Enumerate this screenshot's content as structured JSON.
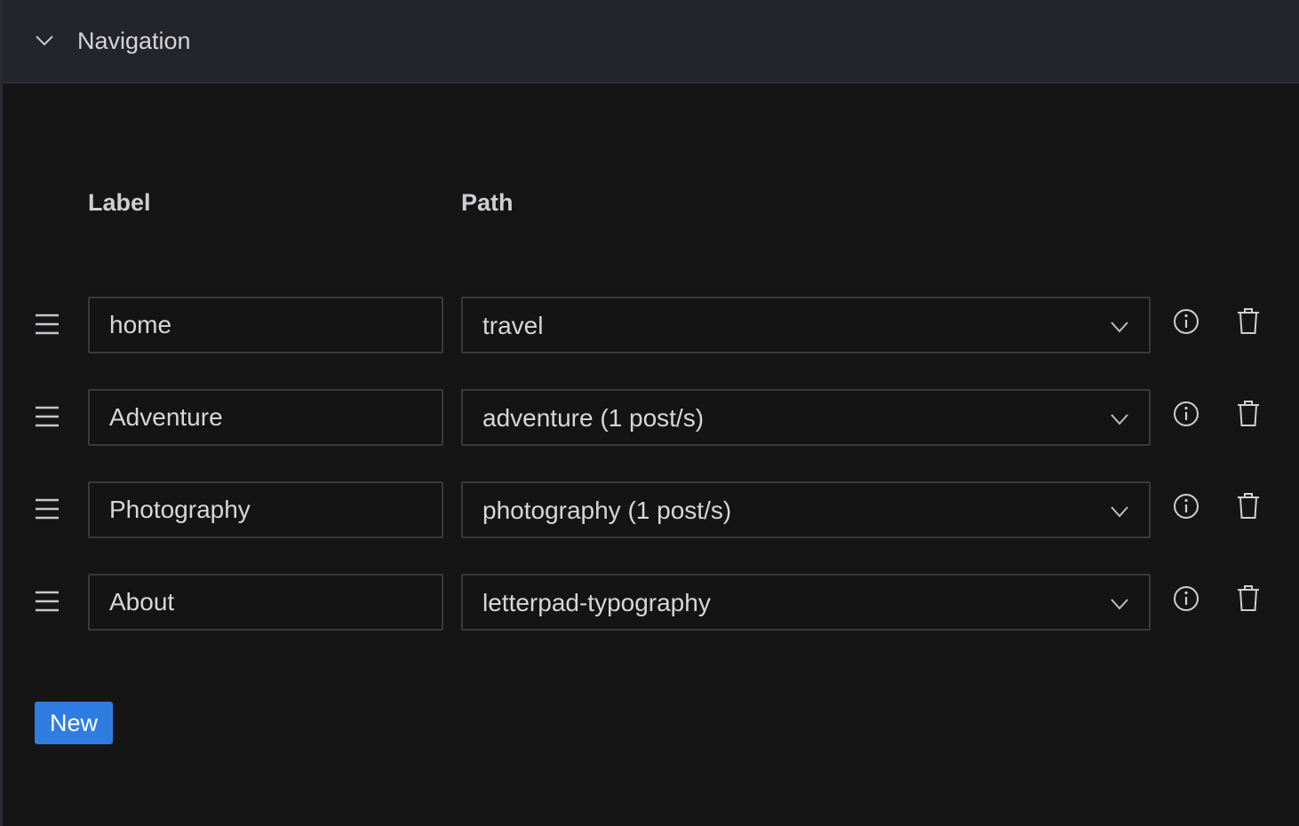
{
  "header": {
    "title": "Navigation",
    "toggle_icon": "chevron-down-icon"
  },
  "columns": {
    "label": "Label",
    "path": "Path"
  },
  "items": [
    {
      "label": "home",
      "path": "travel"
    },
    {
      "label": "Adventure",
      "path": "adventure (1 post/s)"
    },
    {
      "label": "Photography",
      "path": "photography (1 post/s)"
    },
    {
      "label": "About",
      "path": "letterpad-typography"
    }
  ],
  "icons": {
    "drag": "drag-handle-icon",
    "info": "info-icon",
    "delete": "trash-icon",
    "select": "chevron-down-icon"
  },
  "actions": {
    "new_label": "New"
  },
  "colors": {
    "background": "#151516",
    "header_background": "#24242b",
    "accent": "#2f7de1",
    "input_border": "#39393f",
    "text": "#d7d7d9"
  }
}
